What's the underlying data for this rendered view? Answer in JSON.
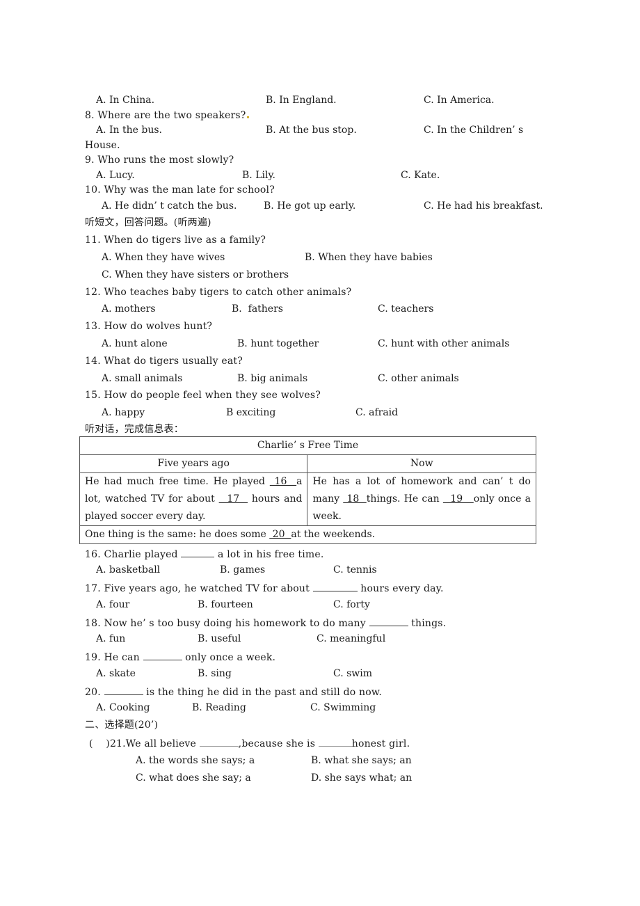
{
  "q7_options": {
    "a": "A. In China.",
    "b": "B. In England.",
    "c": "C. In America."
  },
  "q8": {
    "question": "8. Where are the two speakers?",
    "a": "A. In the bus.",
    "b": "B. At the bus stop.",
    "c": "C. In the Children’ s",
    "c_cont": "House."
  },
  "q9": {
    "question": "9. Who runs the most slowly?",
    "a": "A. Lucy.",
    "b": "B. Lily.",
    "c": "C. Kate."
  },
  "q10": {
    "question": "10. Why was the man late for school?",
    "a": "A. He didn’ t catch the bus.",
    "b": "B. He got up early.",
    "c": "C. He had his breakfast."
  },
  "section_passage": "听短文，回答问题。(听两遍)",
  "q11": {
    "question": "11. When do tigers live as a family?",
    "a": "A. When they have wives",
    "b": "B. When they have babies",
    "c": "C. When they have sisters or brothers"
  },
  "q12": {
    "question": "12. Who teaches baby tigers to catch other animals?",
    "a": "A. mothers",
    "b": "B.  fathers",
    "c": "C. teachers"
  },
  "q13": {
    "question": "13. How do wolves hunt?",
    "a": "A. hunt alone",
    "b": "B. hunt together",
    "c": "C. hunt with other animals"
  },
  "q14": {
    "question": "14. What do tigers usually eat?",
    "a": "A. small animals",
    "b": "B. big animals",
    "c": "C. other animals"
  },
  "q15": {
    "question": "15. How do people feel when they see wolves?",
    "a": "A. happy",
    "b": "B exciting",
    "c": "C. afraid"
  },
  "section_dialogue": "听对话，完成信息表：",
  "info_table": {
    "title": "Charlie’ s Free Time",
    "col_past": "Five years ago",
    "col_now": "Now",
    "past_text": {
      "p1": "He had much free time. He played ",
      "blank16": " 16  ",
      "p2": "a lot, watched TV for about ",
      "blank17": "  17  ",
      "p3": " hours and played soccer every day."
    },
    "now_text": {
      "p1": "He has a lot of homework and can’ t do many  ",
      "blank18": " 18  ",
      "p2": "things.  He  can  ",
      "blank19": "  19   ",
      "p3": "only once a week."
    },
    "same_text": {
      "p1": "One thing is the same: he does some ",
      "blank20": " 20  ",
      "p2": "at the weekends."
    }
  },
  "q16": {
    "question_pre": "16. Charlie played ",
    "question_post": " a lot in his free time.",
    "a": "A. basketball",
    "b": "B. games",
    "c": "C. tennis"
  },
  "q17": {
    "question_pre": "17. Five years ago, he watched TV for about ",
    "question_post": " hours every day.",
    "a": "A. four",
    "b": "B. fourteen",
    "c": "C. forty"
  },
  "q18": {
    "question_pre": "18. Now he’ s too busy doing his homework to do many ",
    "question_post": " things.",
    "a": "A. fun",
    "b": "B. useful",
    "c": "C. meaningful"
  },
  "q19": {
    "question_pre": "19. He can ",
    "question_post": " only once a week.",
    "a": "A. skate",
    "b": "B. sing",
    "c": "C. swim"
  },
  "q20": {
    "question_pre": "20. ",
    "question_post": " is the thing he did in the past and still do now.",
    "a": "A. Cooking",
    "b": "B. Reading",
    "c": "C. Swimming"
  },
  "section_choice": "二、选择题(20’)",
  "q21": {
    "bracket": "(    )",
    "question_pre": "21.We all believe ",
    "question_mid": ",because she is ",
    "question_post": "honest girl.",
    "a": "A. the words she says; a",
    "b": "B. what she says; an",
    "c": "C. what does she say; a",
    "d": "D. she says what; an"
  }
}
